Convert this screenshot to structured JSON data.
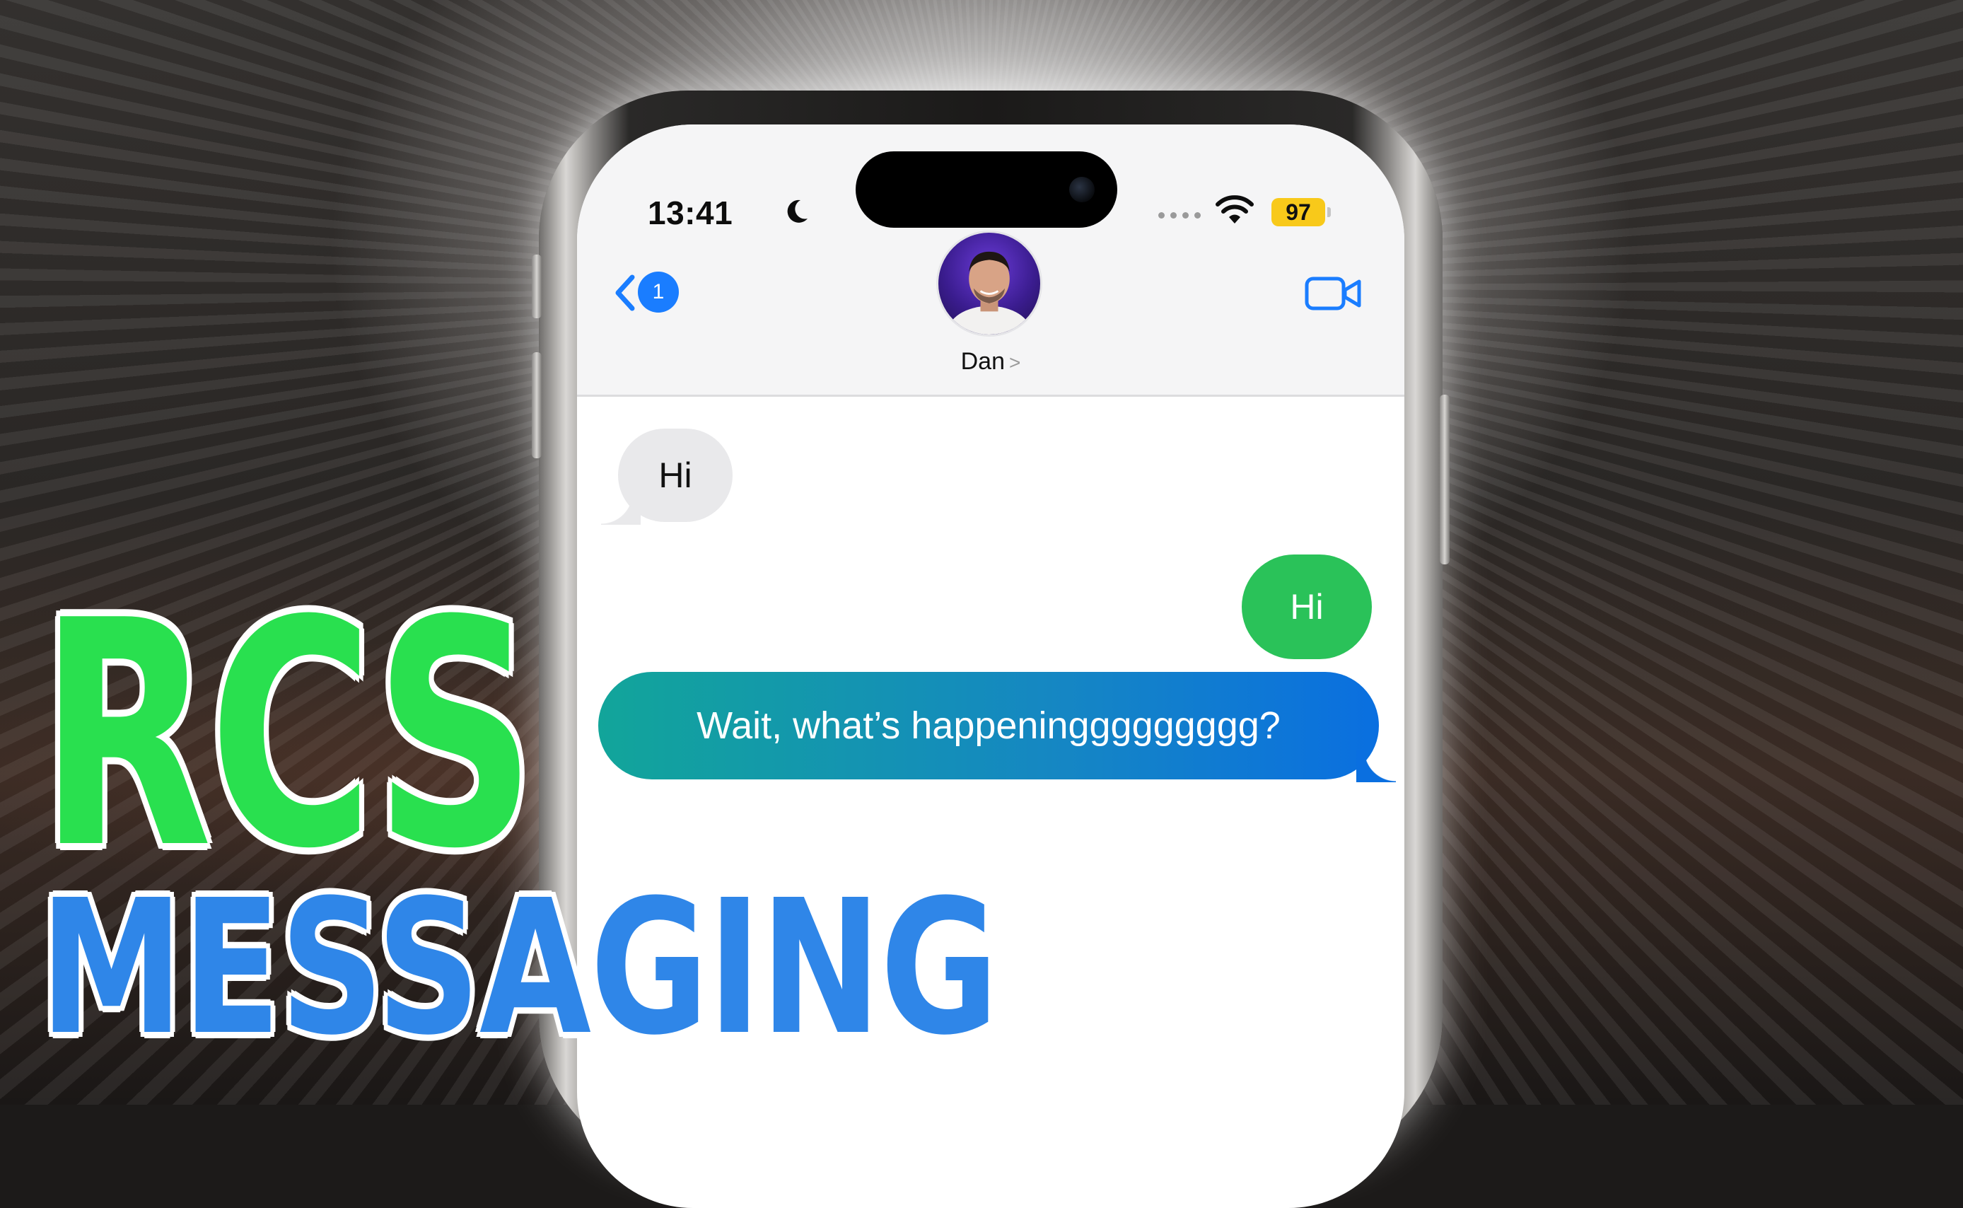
{
  "status_bar": {
    "time": "13:41",
    "battery": "97",
    "battery_color": "#f8c91a"
  },
  "nav": {
    "back_badge": "1",
    "contact_name": "Dan",
    "chevron": ">",
    "accent": "#1a7dff"
  },
  "messages": [
    {
      "direction": "incoming",
      "text": "Hi"
    },
    {
      "direction": "outgoing",
      "text": "Hi",
      "color": "#2ac259"
    },
    {
      "direction": "outgoing",
      "text": "Wait, what’s happeninggggggggg?",
      "color": "#1586c4"
    }
  ],
  "headline": {
    "line1": "RCS",
    "line2": "MESSAGING",
    "line1_color": "#29e04f",
    "line2_color": "#2f86e8"
  },
  "icons": [
    "moon-icon",
    "wifi-icon",
    "back-chevron-icon",
    "video-camera-icon",
    "avatar-photo"
  ]
}
